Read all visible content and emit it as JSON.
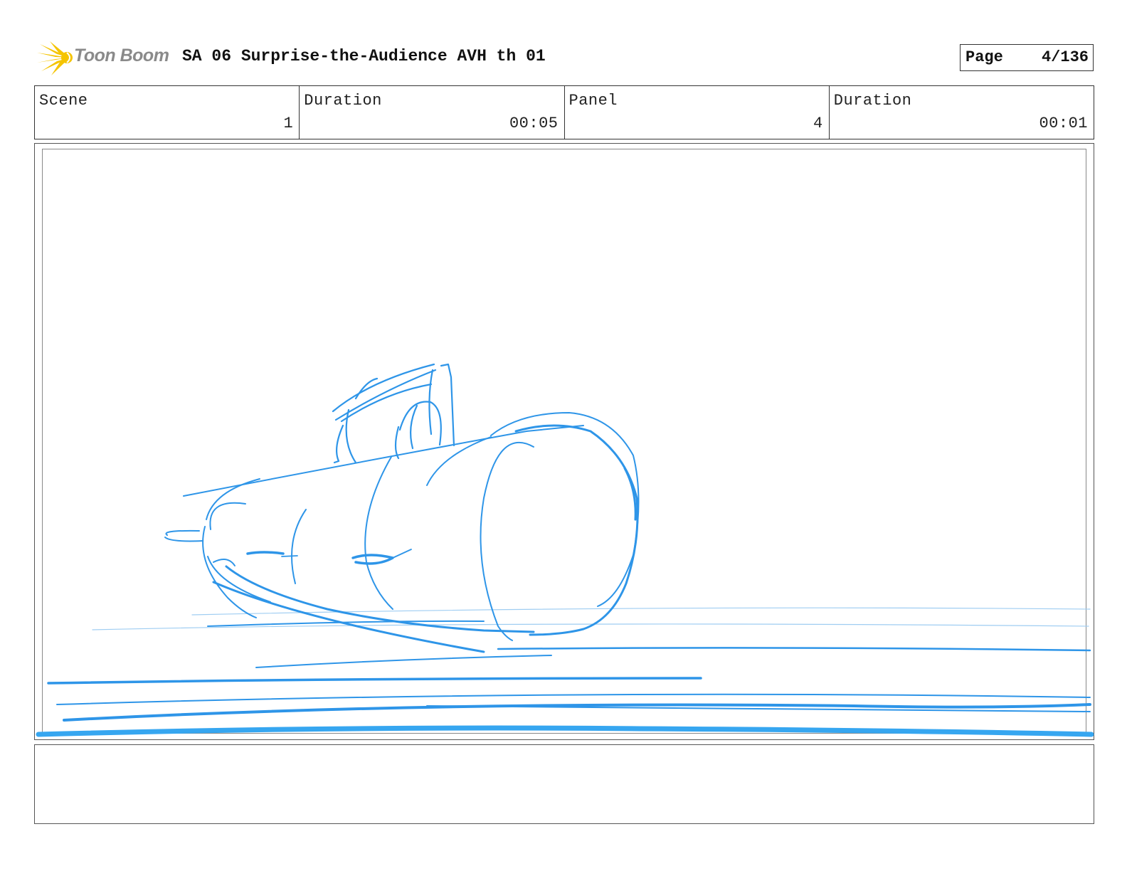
{
  "header": {
    "logo_text": "Toon Boom",
    "title": "SA 06 Surprise-the-Audience AVH th 01",
    "page_label": "Page",
    "page_value": "4/136"
  },
  "info": {
    "scene_label": "Scene",
    "scene_value": "1",
    "scene_duration_label": "Duration",
    "scene_duration_value": "00:05",
    "panel_label": "Panel",
    "panel_value": "4",
    "panel_duration_label": "Duration",
    "panel_duration_value": "00:01"
  },
  "colors": {
    "sketch_blue": "#2e95e8",
    "logo_yellow": "#f5c400",
    "logo_text_gray": "#8a8a8a"
  },
  "notes": {
    "text": ""
  }
}
